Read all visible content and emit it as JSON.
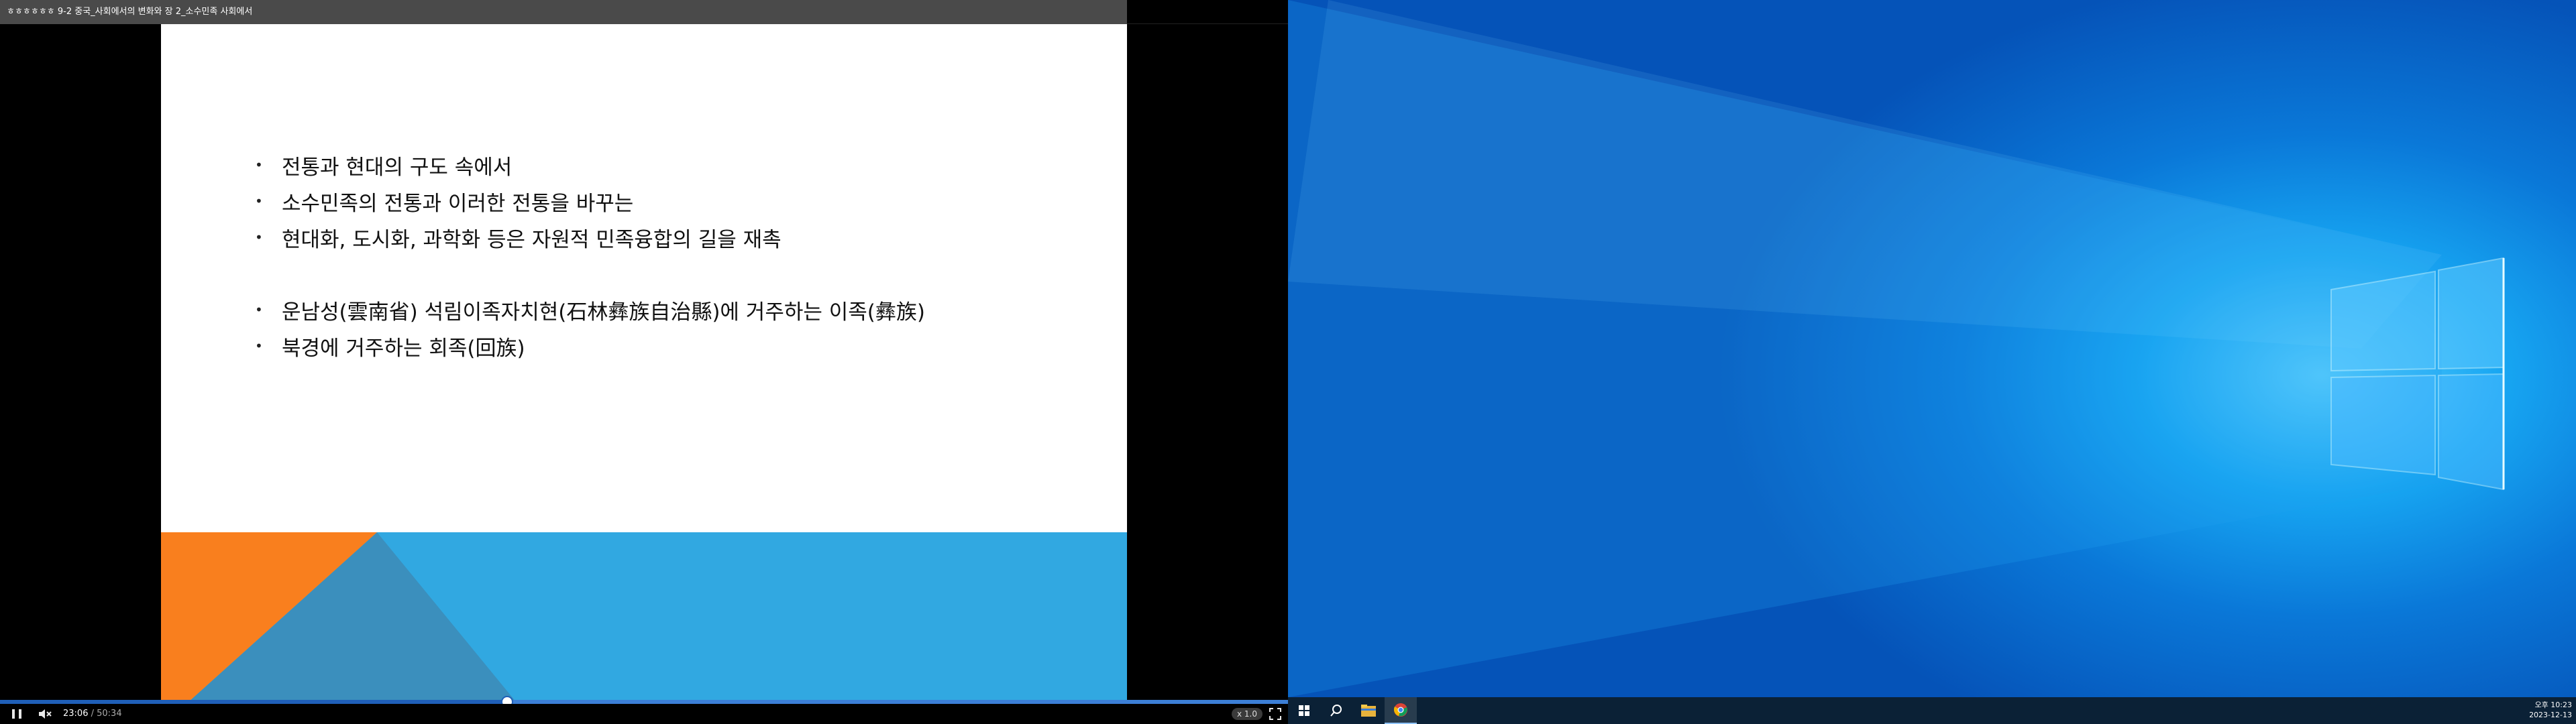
{
  "player": {
    "title": "ㅎㅎㅎㅎㅎㅎ 9-2 중국_사회에서의 변화와 장 2_소수민족 사회에서",
    "slide": {
      "bullets": [
        "전통과 현대의 구도 속에서",
        "소수민족의 전통과 이러한 전통을 바꾸는",
        "현대화, 도시화, 과학화 등은 자원적 민족융합의 길을 재촉",
        "운남성(雲南省) 석림이족자치현(石林彝族自治縣)에 거주하는 이족(彝族)",
        "북경에 거주하는 회족(回族)"
      ],
      "bullet_glyph": "•",
      "colors": {
        "orange": "#f97f1e",
        "blue": "#31a8e1",
        "dark_blue": "#3b8fbd"
      }
    },
    "controls": {
      "current_time": "23:06",
      "separator": " / ",
      "duration": "50:34",
      "progress_fraction": 0.394,
      "speed": "x 1.0"
    },
    "icons": {
      "play_pause": "pause-icon",
      "volume": "volume-icon",
      "fullscreen": "fullscreen-icon"
    }
  },
  "desktop": {
    "taskbar": {
      "apps": [
        "windows-start",
        "search",
        "file-explorer",
        "chrome"
      ],
      "clock_time": "오후 10:23",
      "clock_date": "2023-12-13"
    },
    "colors": {
      "taskbar": "#0b2136",
      "accent": "#0a78d8"
    }
  }
}
